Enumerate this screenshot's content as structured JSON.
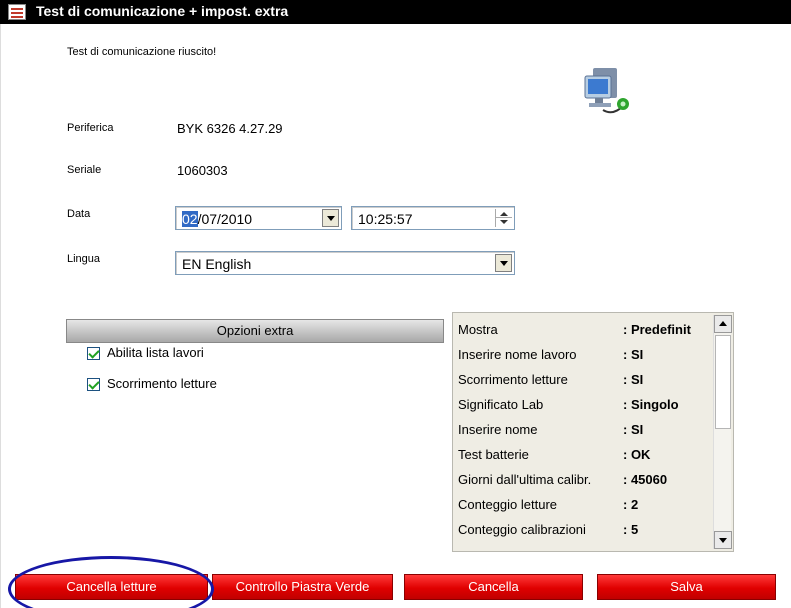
{
  "window": {
    "title": "Test di comunicazione + impost. extra"
  },
  "status_message": "Test di comunicazione riuscito!",
  "icons": {
    "app": "app-icon",
    "computer": "computer-network-icon"
  },
  "fields": {
    "device": {
      "label": "Periferica",
      "value": "BYK 6326 4.27.29"
    },
    "serial": {
      "label": "Seriale",
      "value": "1060303"
    },
    "date": {
      "label": "Data",
      "day_selected": "02",
      "rest": "/07/2010",
      "time": "10:25:57"
    },
    "language": {
      "label": "Lingua",
      "selected": "EN English"
    }
  },
  "extra_options": {
    "header": "Opzioni extra",
    "checkboxes": [
      {
        "label": "Abilita lista lavori",
        "checked": true
      },
      {
        "label": "Scorrimento letture",
        "checked": true
      }
    ]
  },
  "info_list": [
    {
      "key": "Mostra",
      "value": ": Predefinit"
    },
    {
      "key": "Inserire nome lavoro",
      "value": ": SI"
    },
    {
      "key": "Scorrimento letture",
      "value": ": SI"
    },
    {
      "key": "Significato Lab",
      "value": ": Singolo"
    },
    {
      "key": "Inserire nome",
      "value": ": SI"
    },
    {
      "key": "Test batterie",
      "value": ": OK"
    },
    {
      "key": "Giorni dall'ultima calibr.",
      "value": ": 45060"
    },
    {
      "key": "Conteggio letture",
      "value": ": 2"
    },
    {
      "key": "Conteggio calibrazioni",
      "value": ": 5"
    }
  ],
  "buttons": {
    "clear_readings": "Cancella letture",
    "green_plate_check": "Controllo Piastra Verde",
    "cancel": "Cancella",
    "save": "Salva"
  },
  "colors": {
    "titlebar": "#000000",
    "button_red": "#e00000",
    "annotation_ellipse": "#1717a6",
    "info_panel_bg": "#efede4"
  }
}
